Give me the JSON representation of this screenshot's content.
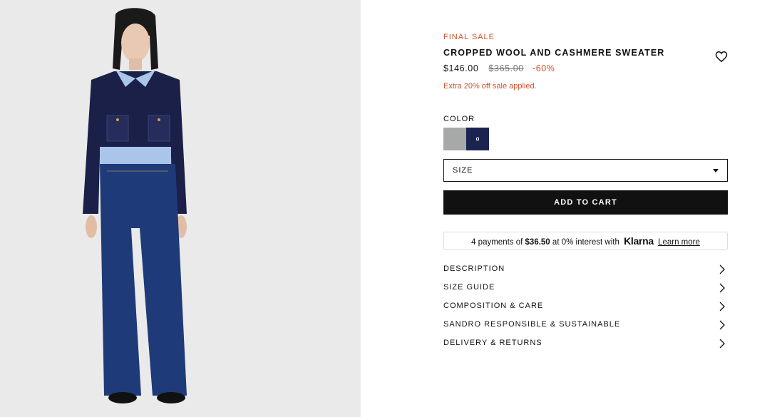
{
  "product": {
    "badge": "FINAL SALE",
    "title": "CROPPED WOOL AND CASHMERE SWEATER",
    "sale_price": "$146.00",
    "original_price": "$365.00",
    "discount": "-60%",
    "extra_note": "Extra 20% off sale applied."
  },
  "color": {
    "label": "COLOR",
    "swatches": [
      {
        "name": "grey",
        "hex": "#a7a8a8"
      },
      {
        "name": "navy",
        "hex": "#1b2450",
        "selected": true
      }
    ]
  },
  "size": {
    "label": "SIZE"
  },
  "cart": {
    "label": "ADD TO CART"
  },
  "klarna": {
    "prefix": "4 payments of",
    "amount": "$36.50",
    "middle": "at 0% interest with",
    "brand": "Klarna",
    "link": "Learn more"
  },
  "accordion": [
    {
      "label": "DESCRIPTION"
    },
    {
      "label": "SIZE GUIDE"
    },
    {
      "label": "COMPOSITION & CARE"
    },
    {
      "label": "SANDRO RESPONSIBLE & SUSTAINABLE"
    },
    {
      "label": "DELIVERY & RETURNS"
    }
  ],
  "icons": {
    "wishlist": "heart-icon",
    "chevron": "chevron-right-icon",
    "caret": "caret-down-icon"
  },
  "colors": {
    "accent": "#d0502c",
    "button": "#111111",
    "photo_bg": "#eaeaea"
  }
}
